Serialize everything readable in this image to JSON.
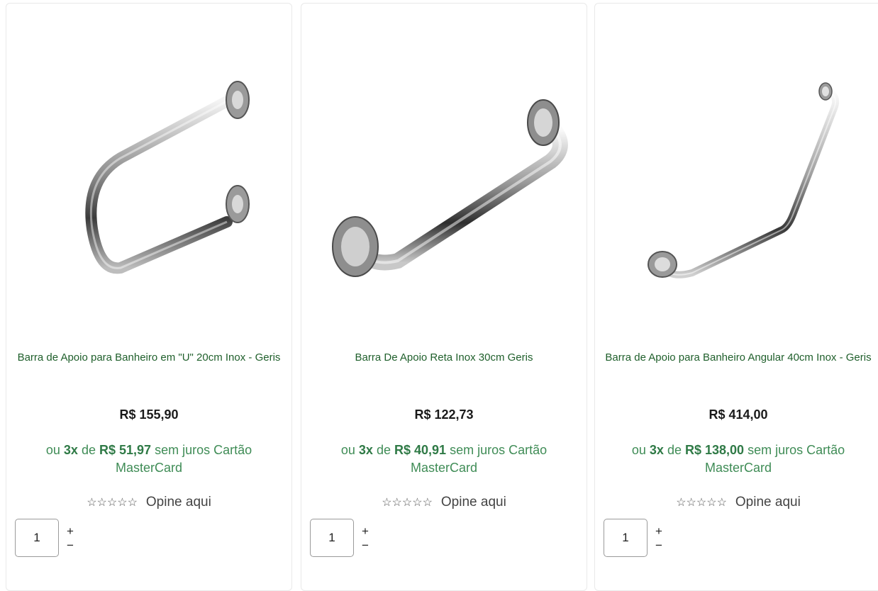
{
  "products": [
    {
      "title": "Barra de Apoio para Banheiro em \"U\" 20cm Inox - Geris",
      "price": "R$ 155,90",
      "installments": {
        "prefix": "ou",
        "count": "3x",
        "middle": "de",
        "amount": "R$ 51,97",
        "suffix": "sem juros Cartão MasterCard"
      },
      "rating_link": "Opine aqui",
      "quantity": "1",
      "image_icon": "u-shaped-grab-bar"
    },
    {
      "title": "Barra De Apoio Reta Inox 30cm Geris",
      "price": "R$ 122,73",
      "installments": {
        "prefix": "ou",
        "count": "3x",
        "middle": "de",
        "amount": "R$ 40,91",
        "suffix": "sem juros Cartão MasterCard"
      },
      "rating_link": "Opine aqui",
      "quantity": "1",
      "image_icon": "straight-grab-bar"
    },
    {
      "title": "Barra de Apoio para Banheiro Angular 40cm Inox - Geris",
      "price": "R$ 414,00",
      "installments": {
        "prefix": "ou",
        "count": "3x",
        "middle": "de",
        "amount": "R$ 138,00",
        "suffix": "sem juros Cartão MasterCard"
      },
      "rating_link": "Opine aqui",
      "quantity": "1",
      "image_icon": "angular-grab-bar"
    }
  ],
  "stepper": {
    "plus": "+",
    "minus": "−"
  },
  "colors": {
    "title": "#1f5f2b",
    "installments": "#3f8c56",
    "border": "#e9e9e9"
  }
}
